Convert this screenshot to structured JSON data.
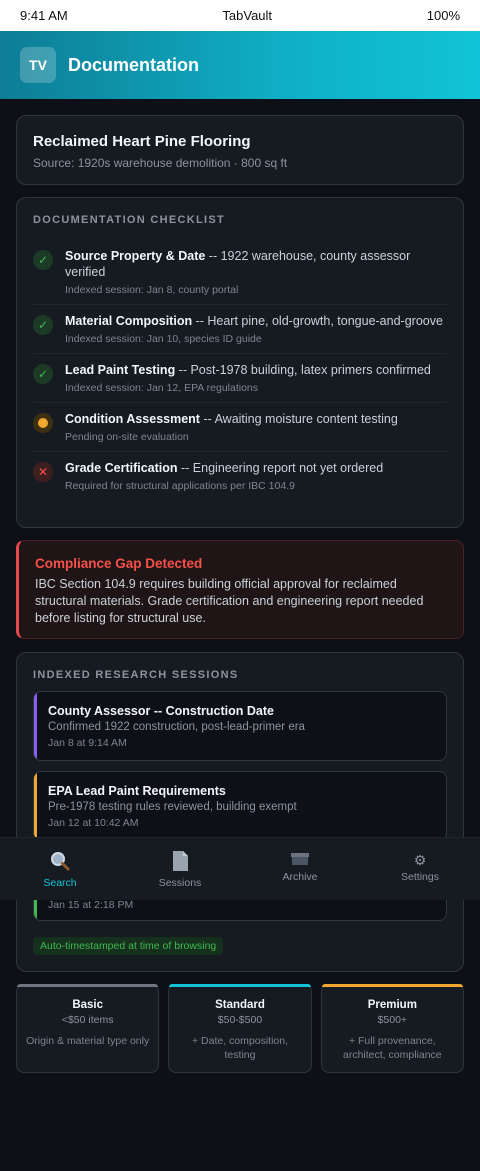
{
  "status_bar": {
    "time": "9:41 AM",
    "app": "TabVault",
    "battery": "100%"
  },
  "header": {
    "logo_text": "TV",
    "title": "Documentation"
  },
  "item": {
    "title": "Reclaimed Heart Pine Flooring",
    "subtitle": "Source: 1920s warehouse demolition · 800 sq ft"
  },
  "checklist": {
    "label": "DOCUMENTATION CHECKLIST",
    "items": [
      {
        "name": "Source Property & Date",
        "detail": " -- 1922 warehouse, county assessor verified",
        "meta": "Indexed session: Jan 8, county portal",
        "status": "ok",
        "icon": "check-icon"
      },
      {
        "name": "Material Composition",
        "detail": " -- Heart pine, old-growth, tongue-and-groove",
        "meta": "Indexed session: Jan 10, species ID guide",
        "status": "ok",
        "icon": "check-icon"
      },
      {
        "name": "Lead Paint Testing",
        "detail": " -- Post-1978 building, latex primers confirmed",
        "meta": "Indexed session: Jan 12, EPA regulations",
        "status": "ok",
        "icon": "check-icon"
      },
      {
        "name": "Condition Assessment",
        "detail": " -- Awaiting moisture content testing",
        "meta": "Pending on-site evaluation",
        "status": "pending",
        "icon": "pending-dot-icon"
      },
      {
        "name": "Grade Certification",
        "detail": " -- Engineering report not yet ordered",
        "meta": "Required for structural applications per IBC 104.9",
        "status": "fail",
        "icon": "x-icon"
      }
    ]
  },
  "alert": {
    "title": "Compliance Gap Detected",
    "text": "IBC Section 104.9 requires building official approval for reclaimed structural materials. Grade certification and engineering report needed before listing for structural use."
  },
  "sessions": {
    "label": "INDEXED RESEARCH SESSIONS",
    "items": [
      {
        "title": "County Assessor -- Construction Date",
        "desc": "Confirmed 1922 construction, post-lead-primer era",
        "time": "Jan 8 at 9:14 AM",
        "color": "#8b5cf6"
      },
      {
        "title": "EPA Lead Paint Requirements",
        "desc": "Pre-1978 testing rules reviewed, building exempt",
        "time": "Jan 12 at 10:42 AM",
        "color": "#f0a830"
      },
      {
        "title": "",
        "desc": "",
        "time": "Jan 15 at 2:18 PM",
        "color": "#3fb950"
      }
    ],
    "badge": "Auto-timestamped at time of browsing"
  },
  "tiers": [
    {
      "name": "Basic",
      "range": "<$50 items",
      "desc": "Origin & material type only",
      "color": "#6e7681"
    },
    {
      "name": "Standard",
      "range": "$50-$500",
      "desc": "+ Date, composition, testing",
      "color": "#12c3d6"
    },
    {
      "name": "Premium",
      "range": "$500+",
      "desc": "+ Full provenance, architect, compliance",
      "color": "#f0a830"
    }
  ],
  "tabbar": [
    {
      "label": "Search",
      "icon": "magnifier-icon",
      "active": true
    },
    {
      "label": "Sessions",
      "icon": "document-icon",
      "active": false
    },
    {
      "label": "Archive",
      "icon": "archive-box-icon",
      "active": false
    },
    {
      "label": "Settings",
      "icon": "gear-icon",
      "active": false
    }
  ]
}
